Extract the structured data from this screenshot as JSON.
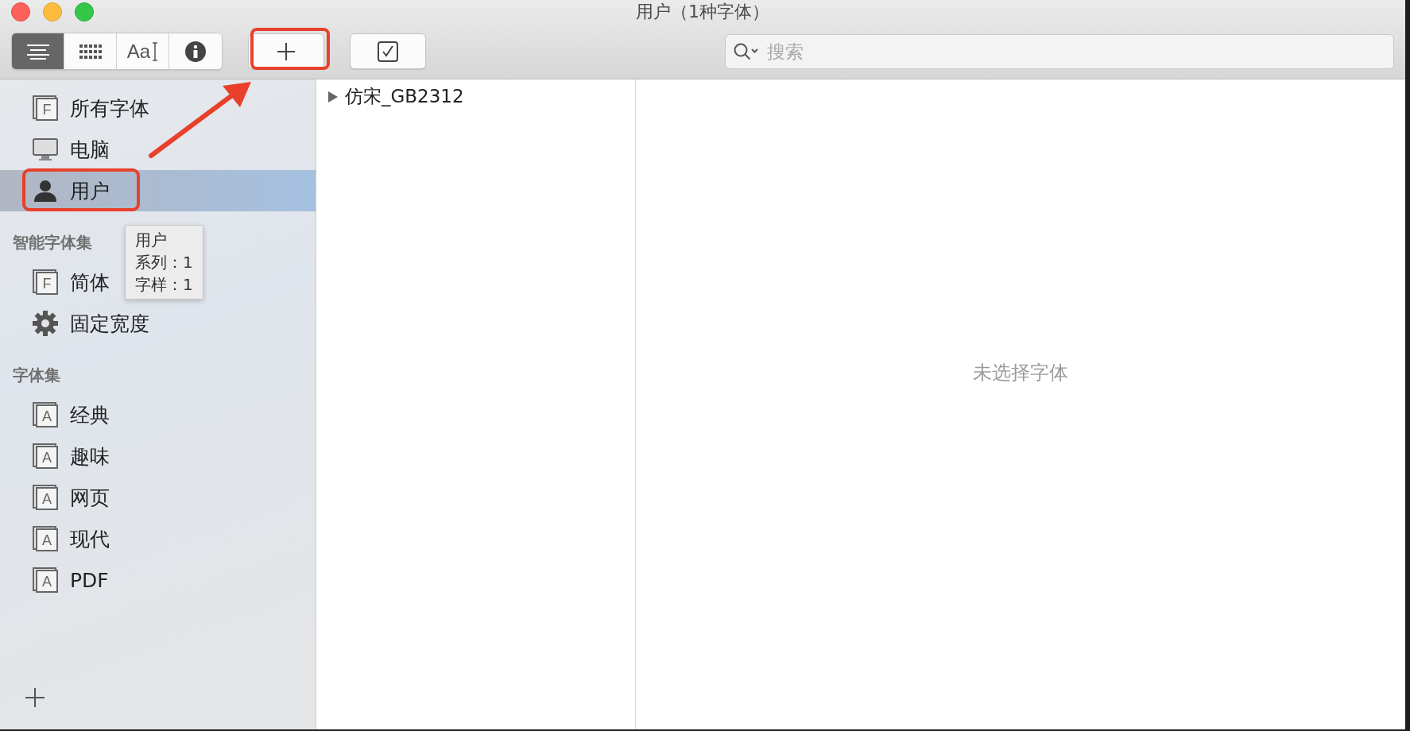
{
  "window": {
    "title": "用户（1种字体）"
  },
  "toolbar": {
    "view_buttons": [
      {
        "kind": "list",
        "selected": true
      },
      {
        "kind": "grid",
        "selected": false
      },
      {
        "kind": "sample",
        "label": "Aa",
        "selected": false
      },
      {
        "kind": "info",
        "selected": false
      }
    ],
    "search": {
      "placeholder": "搜索"
    }
  },
  "sidebar": {
    "library": [
      {
        "kind": "font",
        "glyph": "F",
        "label": "所有字体",
        "selected": false
      },
      {
        "kind": "computer",
        "label": "电脑",
        "selected": false
      },
      {
        "kind": "user",
        "label": "用户",
        "selected": true
      }
    ],
    "sections": [
      {
        "title": "智能字体集",
        "items": [
          {
            "kind": "font",
            "glyph": "F",
            "label": "简体",
            "selected": false
          },
          {
            "kind": "gear",
            "label": "固定宽度",
            "selected": false
          }
        ]
      },
      {
        "title": "字体集",
        "items": [
          {
            "kind": "collection",
            "glyph": "A",
            "label": "经典",
            "selected": false
          },
          {
            "kind": "collection",
            "glyph": "A",
            "label": "趣味",
            "selected": false
          },
          {
            "kind": "collection",
            "glyph": "A",
            "label": "网页",
            "selected": false
          },
          {
            "kind": "collection",
            "glyph": "A",
            "label": "现代",
            "selected": false
          },
          {
            "kind": "collection",
            "glyph": "A",
            "label": "PDF",
            "selected": false
          }
        ]
      }
    ]
  },
  "tooltip": {
    "lines": [
      "用户",
      "系列：1",
      "字样：1"
    ]
  },
  "font_list": [
    {
      "name": "仿宋_GB2312",
      "expanded": false
    }
  ],
  "preview": {
    "empty_text": "未选择字体"
  }
}
